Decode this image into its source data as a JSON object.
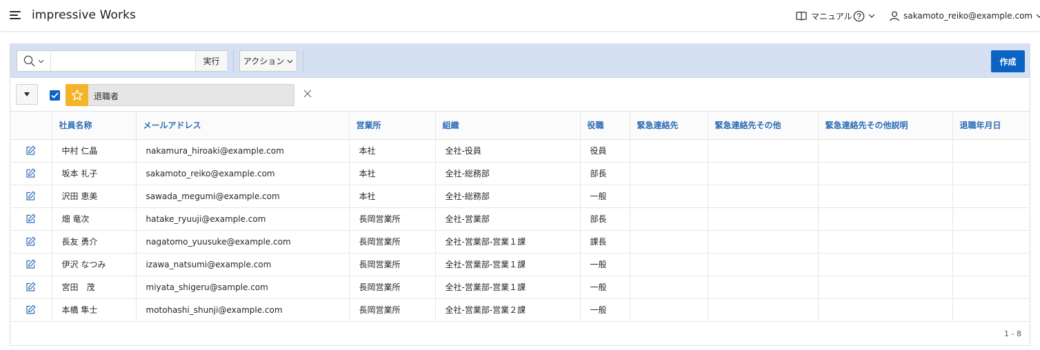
{
  "header": {
    "app_title": "impressive Works",
    "manual_label": "マニュアル",
    "user_label": "sakamoto_reiko@example.com"
  },
  "toolbar": {
    "search_value": "",
    "go_label": "実行",
    "actions_label": "アクション",
    "create_label": "作成"
  },
  "filter": {
    "label": "退職者",
    "checked": true
  },
  "table": {
    "columns": [
      "社員名称",
      "メールアドレス",
      "営業所",
      "組織",
      "役職",
      "緊急連絡先",
      "緊急連絡先その他",
      "緊急連絡先その他説明",
      "退職年月日"
    ],
    "rows": [
      {
        "name": "中村 仁晶",
        "email": "nakamura_hiroaki@example.com",
        "office": "本社",
        "org": "全社-役員",
        "title": "役員",
        "contact": "",
        "contact_other": "",
        "contact_other_desc": "",
        "retire_date": ""
      },
      {
        "name": "坂本 礼子",
        "email": "sakamoto_reiko@example.com",
        "office": "本社",
        "org": "全社-総務部",
        "title": "部長",
        "contact": "",
        "contact_other": "",
        "contact_other_desc": "",
        "retire_date": ""
      },
      {
        "name": "沢田 恵美",
        "email": "sawada_megumi@example.com",
        "office": "本社",
        "org": "全社-総務部",
        "title": "一般",
        "contact": "",
        "contact_other": "",
        "contact_other_desc": "",
        "retire_date": ""
      },
      {
        "name": "畑 竜次",
        "email": "hatake_ryuuji@example.com",
        "office": "長岡営業所",
        "org": "全社-営業部",
        "title": "部長",
        "contact": "",
        "contact_other": "",
        "contact_other_desc": "",
        "retire_date": ""
      },
      {
        "name": "長友 勇介",
        "email": "nagatomo_yuusuke@example.com",
        "office": "長岡営業所",
        "org": "全社-営業部-営業１課",
        "title": "課長",
        "contact": "",
        "contact_other": "",
        "contact_other_desc": "",
        "retire_date": ""
      },
      {
        "name": "伊沢 なつみ",
        "email": "izawa_natsumi@example.com",
        "office": "長岡営業所",
        "org": "全社-営業部-営業１課",
        "title": "一般",
        "contact": "",
        "contact_other": "",
        "contact_other_desc": "",
        "retire_date": ""
      },
      {
        "name": "宮田　茂",
        "email": "miyata_shigeru@sample.com",
        "office": "長岡営業所",
        "org": "全社-営業部-営業１課",
        "title": "一般",
        "contact": "",
        "contact_other": "",
        "contact_other_desc": "",
        "retire_date": ""
      },
      {
        "name": "本橋 隼士",
        "email": "motohashi_shunji@example.com",
        "office": "長岡営業所",
        "org": "全社-営業部-営業２課",
        "title": "一般",
        "contact": "",
        "contact_other": "",
        "contact_other_desc": "",
        "retire_date": ""
      }
    ]
  },
  "pagination": "1 - 8",
  "colors": {
    "toolbar_bg": "#d5e1f3",
    "primary": "#0b63c4",
    "header_link": "#2c6cb7",
    "filter_star": "#f5b32a"
  },
  "icons": {
    "menu": "hamburger-icon",
    "manual": "book-icon",
    "help": "question-circle-icon",
    "user": "user-icon",
    "search": "search-icon",
    "edit": "edit-icon",
    "star": "star-icon",
    "remove": "close-icon"
  }
}
